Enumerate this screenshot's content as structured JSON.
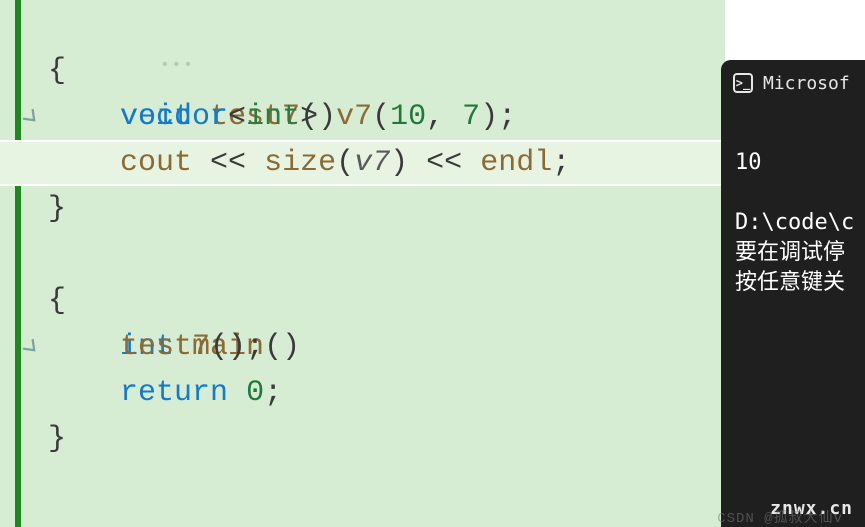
{
  "editor": {
    "lines": [
      {
        "type": "sig",
        "fold": true,
        "tokens": {
          "kw": "void",
          "sp": " ",
          "fn": "test7",
          "paren": "()"
        }
      },
      {
        "type": "brace_open"
      },
      {
        "type": "vector",
        "indent": "    ",
        "tokens": {
          "ty": "vector",
          "ang_open": "<",
          "tmpl": "int",
          "ang_close": ">",
          "sp": " ",
          "var": "v7",
          "paren_open": "(",
          "n1": "10",
          "comma": ", ",
          "n2": "7",
          "paren_close_semi": ");"
        }
      },
      {
        "type": "cout",
        "indent": "    ",
        "current": true,
        "tokens": {
          "cout": "cout",
          "sp1": " ",
          "op1": "<<",
          "sp2": " ",
          "size": "size",
          "paren_open": "(",
          "arg": "v7",
          "paren_close": ")",
          "sp3": " ",
          "op2": "<<",
          "sp4": " ",
          "endl": "endl",
          "semi": ";"
        }
      },
      {
        "type": "brace_close"
      },
      {
        "type": "sig",
        "fold": true,
        "tokens": {
          "kw": "int",
          "sp": " ",
          "fn": "main",
          "paren": "()"
        }
      },
      {
        "type": "brace_open"
      },
      {
        "type": "call",
        "indent": "    ",
        "tokens": {
          "fn": "test7",
          "paren": "()",
          "semi": ";"
        }
      },
      {
        "type": "return",
        "indent": "    ",
        "tokens": {
          "kw": "return",
          "sp": " ",
          "num": "0",
          "semi": ";"
        }
      },
      {
        "type": "brace_close"
      }
    ],
    "brace_open": "{",
    "brace_close": "}",
    "ellipsis": "•••"
  },
  "terminal": {
    "title": "Microsof",
    "output": "10",
    "path": "D:\\code\\c",
    "msg1": "要在调试停",
    "msg2": "按任意键关"
  },
  "watermarks": {
    "znwx": "znwx.cn",
    "csdn": "CSDN @孤叔大仙v"
  }
}
